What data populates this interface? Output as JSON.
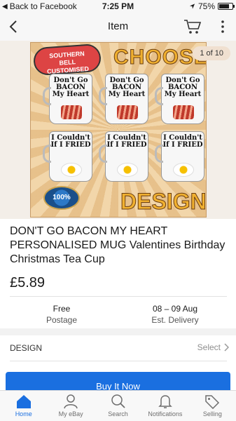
{
  "status_bar": {
    "back_app": "Back to Facebook",
    "time": "7:25 PM",
    "battery": "75%",
    "battery_level": 0.75
  },
  "nav": {
    "title": "Item"
  },
  "hero": {
    "counter": "1 of 10",
    "art": {
      "brand_lines": [
        "SOUTHERN",
        "BELL",
        "CUSTOMISED"
      ],
      "choose": "CHOOSE",
      "design": "DESIGN",
      "seal": "100%",
      "mugs": [
        {
          "text": "Don't Go BACON My Heart",
          "pic": "bacon"
        },
        {
          "text": "Don't Go BACON My Heart",
          "pic": "bacon"
        },
        {
          "text": "Don't Go BACON My Heart",
          "pic": "bacon"
        },
        {
          "text": "I Couldn't If I FRIED",
          "pic": "egg"
        },
        {
          "text": "I Couldn't If I FRIED",
          "pic": "egg"
        },
        {
          "text": "I Couldn't If I FRIED",
          "pic": "egg"
        }
      ]
    }
  },
  "product": {
    "title": "DON'T GO BACON MY HEART PERSONALISED MUG Valentines Birthday Christmas Tea Cup",
    "price": "£5.89"
  },
  "shipping": {
    "postage_value": "Free",
    "postage_label": "Postage",
    "delivery_value": "08 – 09 Aug",
    "delivery_label": "Est. Delivery"
  },
  "variation": {
    "label": "DESIGN",
    "value": "Select"
  },
  "buy_button": "Buy It Now",
  "tabs": [
    {
      "label": "Home",
      "icon": "home-icon",
      "active": true
    },
    {
      "label": "My eBay",
      "icon": "person-icon",
      "active": false
    },
    {
      "label": "Search",
      "icon": "search-icon",
      "active": false
    },
    {
      "label": "Notifications",
      "icon": "bell-icon",
      "active": false
    },
    {
      "label": "Selling",
      "icon": "tag-icon",
      "active": false
    }
  ],
  "colors": {
    "accent": "#1a6fe0"
  }
}
